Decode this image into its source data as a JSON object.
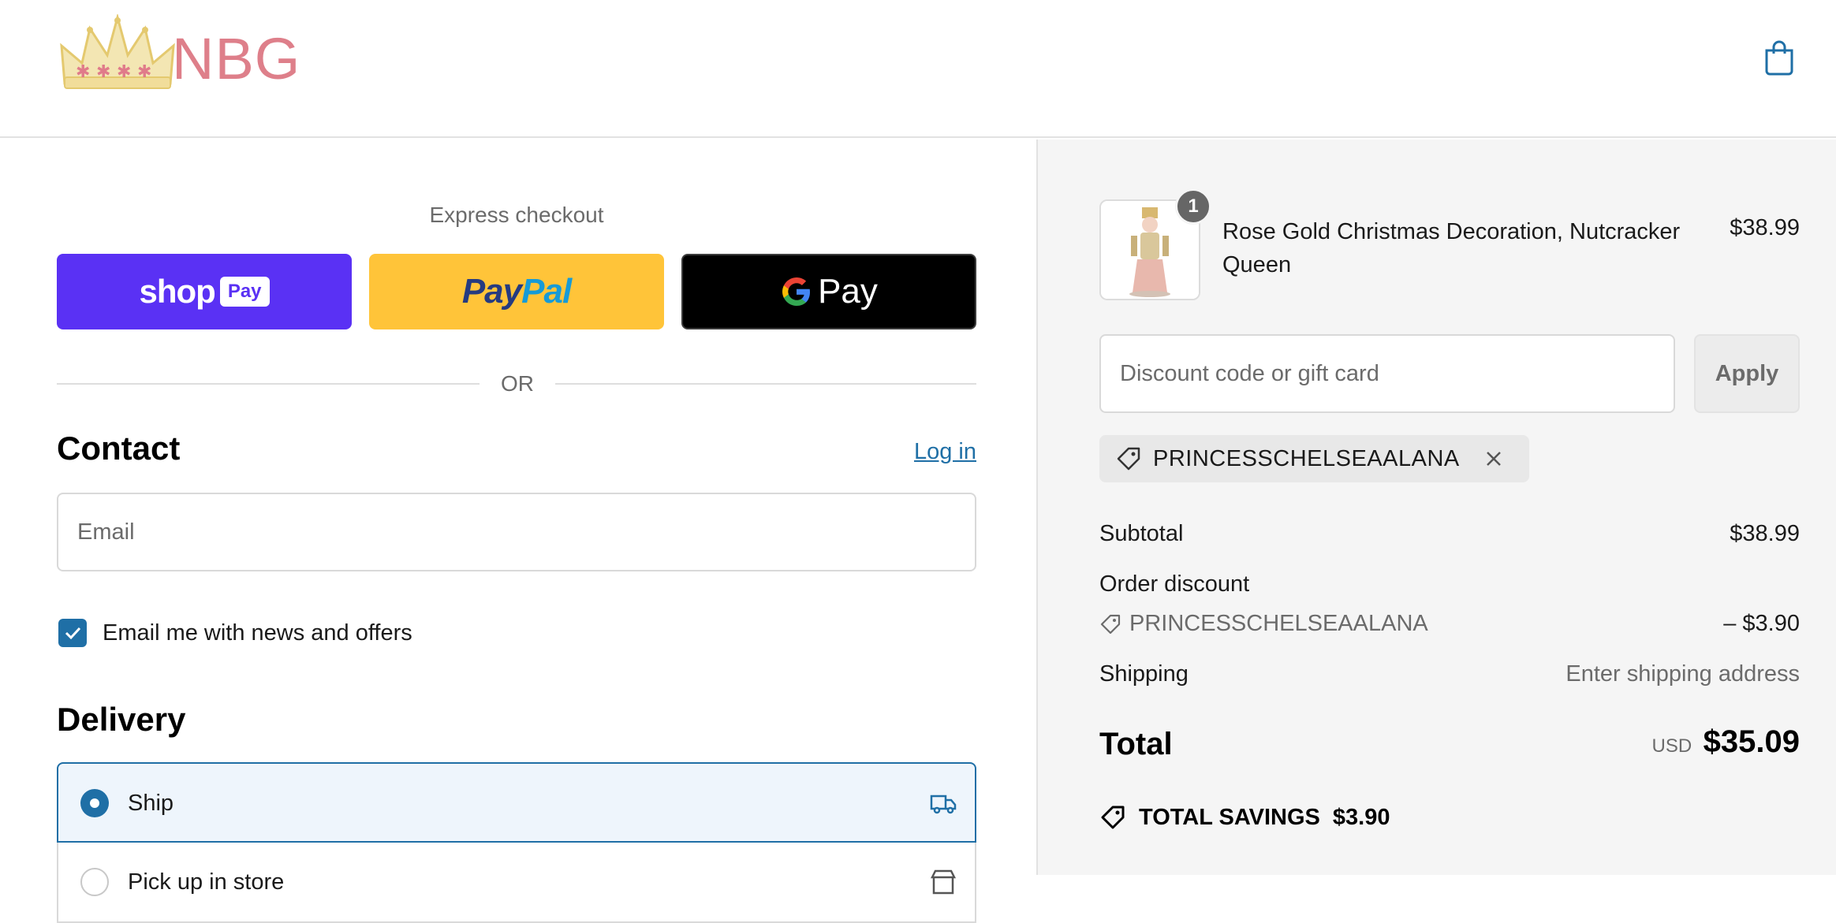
{
  "header": {
    "brand": "NBG",
    "cart_icon": "shopping-bag-icon"
  },
  "express": {
    "title": "Express checkout",
    "shop_pay": {
      "word": "shop",
      "badge": "Pay"
    },
    "paypal": {
      "part1": "Pay",
      "part2": "Pal"
    },
    "google_pay": {
      "word": "Pay"
    },
    "or_label": "OR"
  },
  "contact": {
    "title": "Contact",
    "login_label": "Log in",
    "email_placeholder": "Email",
    "newsletter_label": "Email me with news and offers",
    "newsletter_checked": true
  },
  "delivery": {
    "title": "Delivery",
    "options": [
      {
        "label": "Ship",
        "selected": true,
        "icon": "truck-icon"
      },
      {
        "label": "Pick up in store",
        "selected": false,
        "icon": "store-icon"
      }
    ]
  },
  "order": {
    "item": {
      "name": "Rose Gold Christmas Decoration, Nutcracker Queen",
      "price": "$38.99",
      "quantity": "1"
    },
    "discount_placeholder": "Discount code or gift card",
    "apply_label": "Apply",
    "applied_code": "PRINCESSCHELSEAALANA",
    "subtotal_label": "Subtotal",
    "subtotal_value": "$38.99",
    "order_discount_label": "Order discount",
    "discount_code": "PRINCESSCHELSEAALANA",
    "discount_value": "– $3.90",
    "shipping_label": "Shipping",
    "shipping_value": "Enter shipping address",
    "total_label": "Total",
    "currency": "USD",
    "total_value": "$35.09",
    "savings_label": "TOTAL SAVINGS",
    "savings_value": "$3.90"
  },
  "colors": {
    "accent": "#1f6fa6",
    "shop_pay": "#5a31f4",
    "paypal": "#ffc439",
    "gpay": "#000000",
    "brand": "#de7f8a"
  }
}
